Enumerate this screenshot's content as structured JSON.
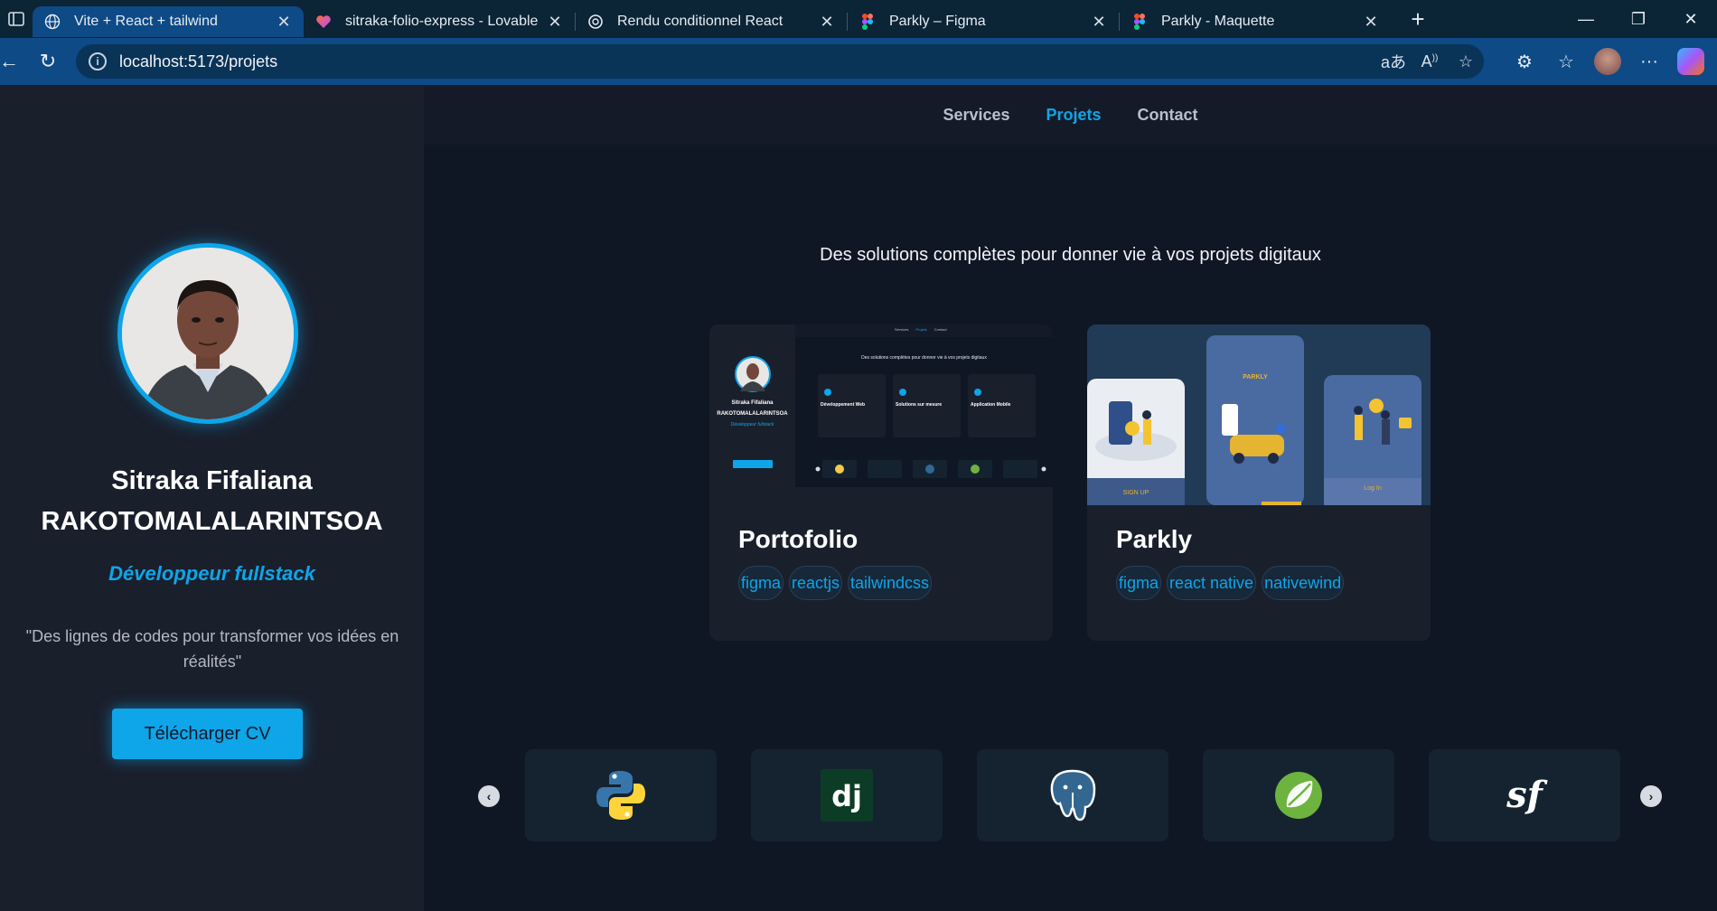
{
  "browser": {
    "tabs": [
      {
        "title": "Vite + React + tailwind",
        "icon": "globe-icon",
        "active": true
      },
      {
        "title": "sitraka-folio-express - Lovable",
        "icon": "lovable-icon",
        "active": false
      },
      {
        "title": "Rendu conditionnel React",
        "icon": "openai-icon",
        "active": false
      },
      {
        "title": "Parkly – Figma",
        "icon": "figma-icon",
        "active": false
      },
      {
        "title": "Parkly - Maquette",
        "icon": "figma-icon",
        "active": false
      }
    ],
    "url": "localhost:5173/projets"
  },
  "sidebar": {
    "name_line1": "Sitraka Fifaliana",
    "name_line2": "RAKOTOMALALARINTSOA",
    "role": "Développeur fullstack",
    "quote": "\"Des lignes de codes pour transformer vos idées en réalités\"",
    "cv_button": "Télécharger CV"
  },
  "nav": {
    "items": [
      "Services",
      "Projets",
      "Contact"
    ],
    "active": "Projets"
  },
  "main": {
    "tagline": "Des solutions complètes pour donner vie à vos projets digitaux",
    "projects": [
      {
        "title": "Portofolio",
        "tags": [
          "figma",
          "reactjs",
          "tailwindcss"
        ]
      },
      {
        "title": "Parkly",
        "tags": [
          "figma",
          "react native",
          "nativewind"
        ]
      }
    ],
    "mini_preview": {
      "nav": [
        "Services",
        "Projets",
        "Contact"
      ],
      "tagline": "Des solutions complètes pour donner vie à vos projets digitaux",
      "name1": "Sitraka Fifaliana",
      "name2": "RAKOTOMALALARINTSOA",
      "role": "Développeur fullstack",
      "cards": [
        "Développement Web",
        "Solutions sur mesure",
        "Application Mobile"
      ]
    },
    "parkly_preview": {
      "brand": "PARKLY",
      "signup": "SIGN UP",
      "login": "Log In"
    },
    "tech_carousel": [
      "python-logo",
      "django-logo",
      "postgresql-logo",
      "spring-logo",
      "symfony-logo"
    ]
  },
  "colors": {
    "accent": "#0ea5e9",
    "sidebar_bg": "#1a1f2c",
    "page_bg": "#0f1624"
  }
}
